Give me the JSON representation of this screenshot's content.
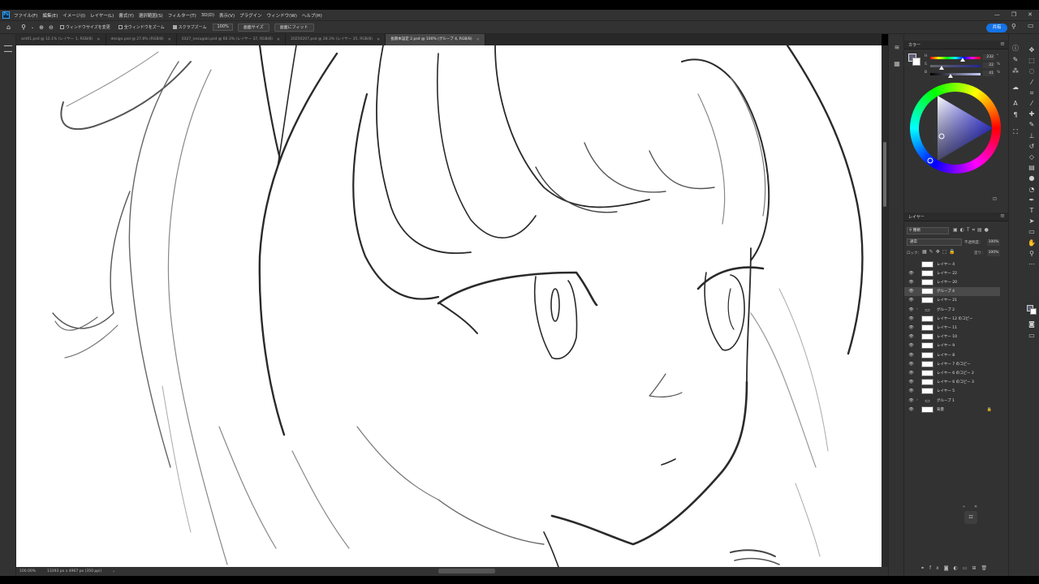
{
  "app": {
    "logo": "Ps",
    "menu": [
      "ファイル(F)",
      "編集(E)",
      "イメージ(I)",
      "レイヤー(L)",
      "書式(Y)",
      "選択範囲(S)",
      "フィルター(T)",
      "3D(D)",
      "表示(V)",
      "プラグイン",
      "ウィンドウ(W)",
      "ヘルプ(H)"
    ],
    "window_controls": [
      "—",
      "❐",
      "✕"
    ]
  },
  "options_bar": {
    "home_icon": "home-icon",
    "zoom_icon": "zoom-icon",
    "resize_windows_label": "ウィンドウサイズを変更",
    "resize_windows_checked": false,
    "zoom_all_label": "全ウィンドウをズーム",
    "zoom_all_checked": false,
    "scrubby_zoom_label": "スクラブズーム",
    "scrubby_zoom_checked": true,
    "zoom_value": "100%",
    "fit_screen_label": "画面サイズ",
    "fill_screen_label": "画面にフィット",
    "share_label": "共有"
  },
  "tabs": [
    {
      "title": "ant01.psd @ 12.1% (レイヤー 1, RGB/8)",
      "active": false
    },
    {
      "title": "design.psd @ 27.8% (RGB/8)",
      "active": false
    },
    {
      "title": "0327_nezugaki.psd @ 66.3% (レイヤー 37, RGB/8)",
      "active": false
    },
    {
      "title": "20250207.psd @ 28.3% (レイヤー 35, RGB/8)",
      "active": false
    },
    {
      "title": "長期本設定 2.psd @ 100% (グループ 4, RGB/8)",
      "active": true
    }
  ],
  "status": {
    "zoom": "100.00%",
    "doc_size": "13393 px x 4967 px (350 ppi)"
  },
  "color_panel": {
    "title": "カラー",
    "sliders": [
      {
        "label": "H",
        "value": "232",
        "unit": "°",
        "position": 0.64
      },
      {
        "label": "S",
        "value": "22",
        "unit": "%",
        "position": 0.22
      },
      {
        "label": "B",
        "value": "41",
        "unit": "%",
        "position": 0.41
      }
    ],
    "hue_color": "#3d3dff"
  },
  "layers_panel": {
    "title": "レイヤー",
    "kind_label": "種類",
    "blend_mode": "通常",
    "opacity_label": "不透明度：",
    "opacity_value": "100%",
    "lock_label": "ロック：",
    "fill_label": "塗り：",
    "fill_value": "100%",
    "layers": [
      {
        "name": "レイヤー 4",
        "visible": false,
        "type": "layer",
        "selected": false
      },
      {
        "name": "レイヤー 22",
        "visible": true,
        "type": "layer",
        "selected": false
      },
      {
        "name": "レイヤー 20",
        "visible": true,
        "type": "layer",
        "selected": false
      },
      {
        "name": "グループ 4",
        "visible": true,
        "type": "layer",
        "selected": true
      },
      {
        "name": "レイヤー 21",
        "visible": true,
        "type": "layer",
        "selected": false
      },
      {
        "name": "グループ 2",
        "visible": true,
        "type": "group",
        "selected": false
      },
      {
        "name": "レイヤー 12 のコピー",
        "visible": true,
        "type": "layer",
        "selected": false
      },
      {
        "name": "レイヤー 11",
        "visible": true,
        "type": "layer",
        "selected": false
      },
      {
        "name": "レイヤー 10",
        "visible": true,
        "type": "layer",
        "selected": false
      },
      {
        "name": "レイヤー 9",
        "visible": true,
        "type": "layer",
        "selected": false
      },
      {
        "name": "レイヤー 8",
        "visible": true,
        "type": "layer",
        "selected": false
      },
      {
        "name": "レイヤー 7 のコピー",
        "visible": true,
        "type": "layer",
        "selected": false
      },
      {
        "name": "レイヤー 6 のコピー 2",
        "visible": true,
        "type": "layer",
        "selected": false
      },
      {
        "name": "レイヤー 6 のコピー 3",
        "visible": true,
        "type": "layer",
        "selected": false
      },
      {
        "name": "レイヤー 5",
        "visible": true,
        "type": "layer",
        "selected": false
      },
      {
        "name": "グループ 1",
        "visible": true,
        "type": "group",
        "selected": false
      },
      {
        "name": "背景",
        "visible": true,
        "type": "layer",
        "selected": false,
        "locked": true
      }
    ],
    "footer_icons": [
      "link-icon",
      "fx-icon",
      "mask-icon",
      "adjustment-icon",
      "folder-icon",
      "new-layer-icon",
      "trash-icon"
    ]
  },
  "tools": [
    "move-icon",
    "marquee-icon",
    "lasso-icon",
    "magic-wand-icon",
    "crop-icon",
    "eyedropper-icon",
    "healing-icon",
    "brush-icon",
    "stamp-icon",
    "history-brush-icon",
    "eraser-icon",
    "gradient-icon",
    "blur-icon",
    "dodge-icon",
    "pen-icon",
    "type-icon",
    "path-select-icon",
    "shape-icon",
    "hand-icon",
    "zoom-tool-icon",
    "more-icon"
  ]
}
